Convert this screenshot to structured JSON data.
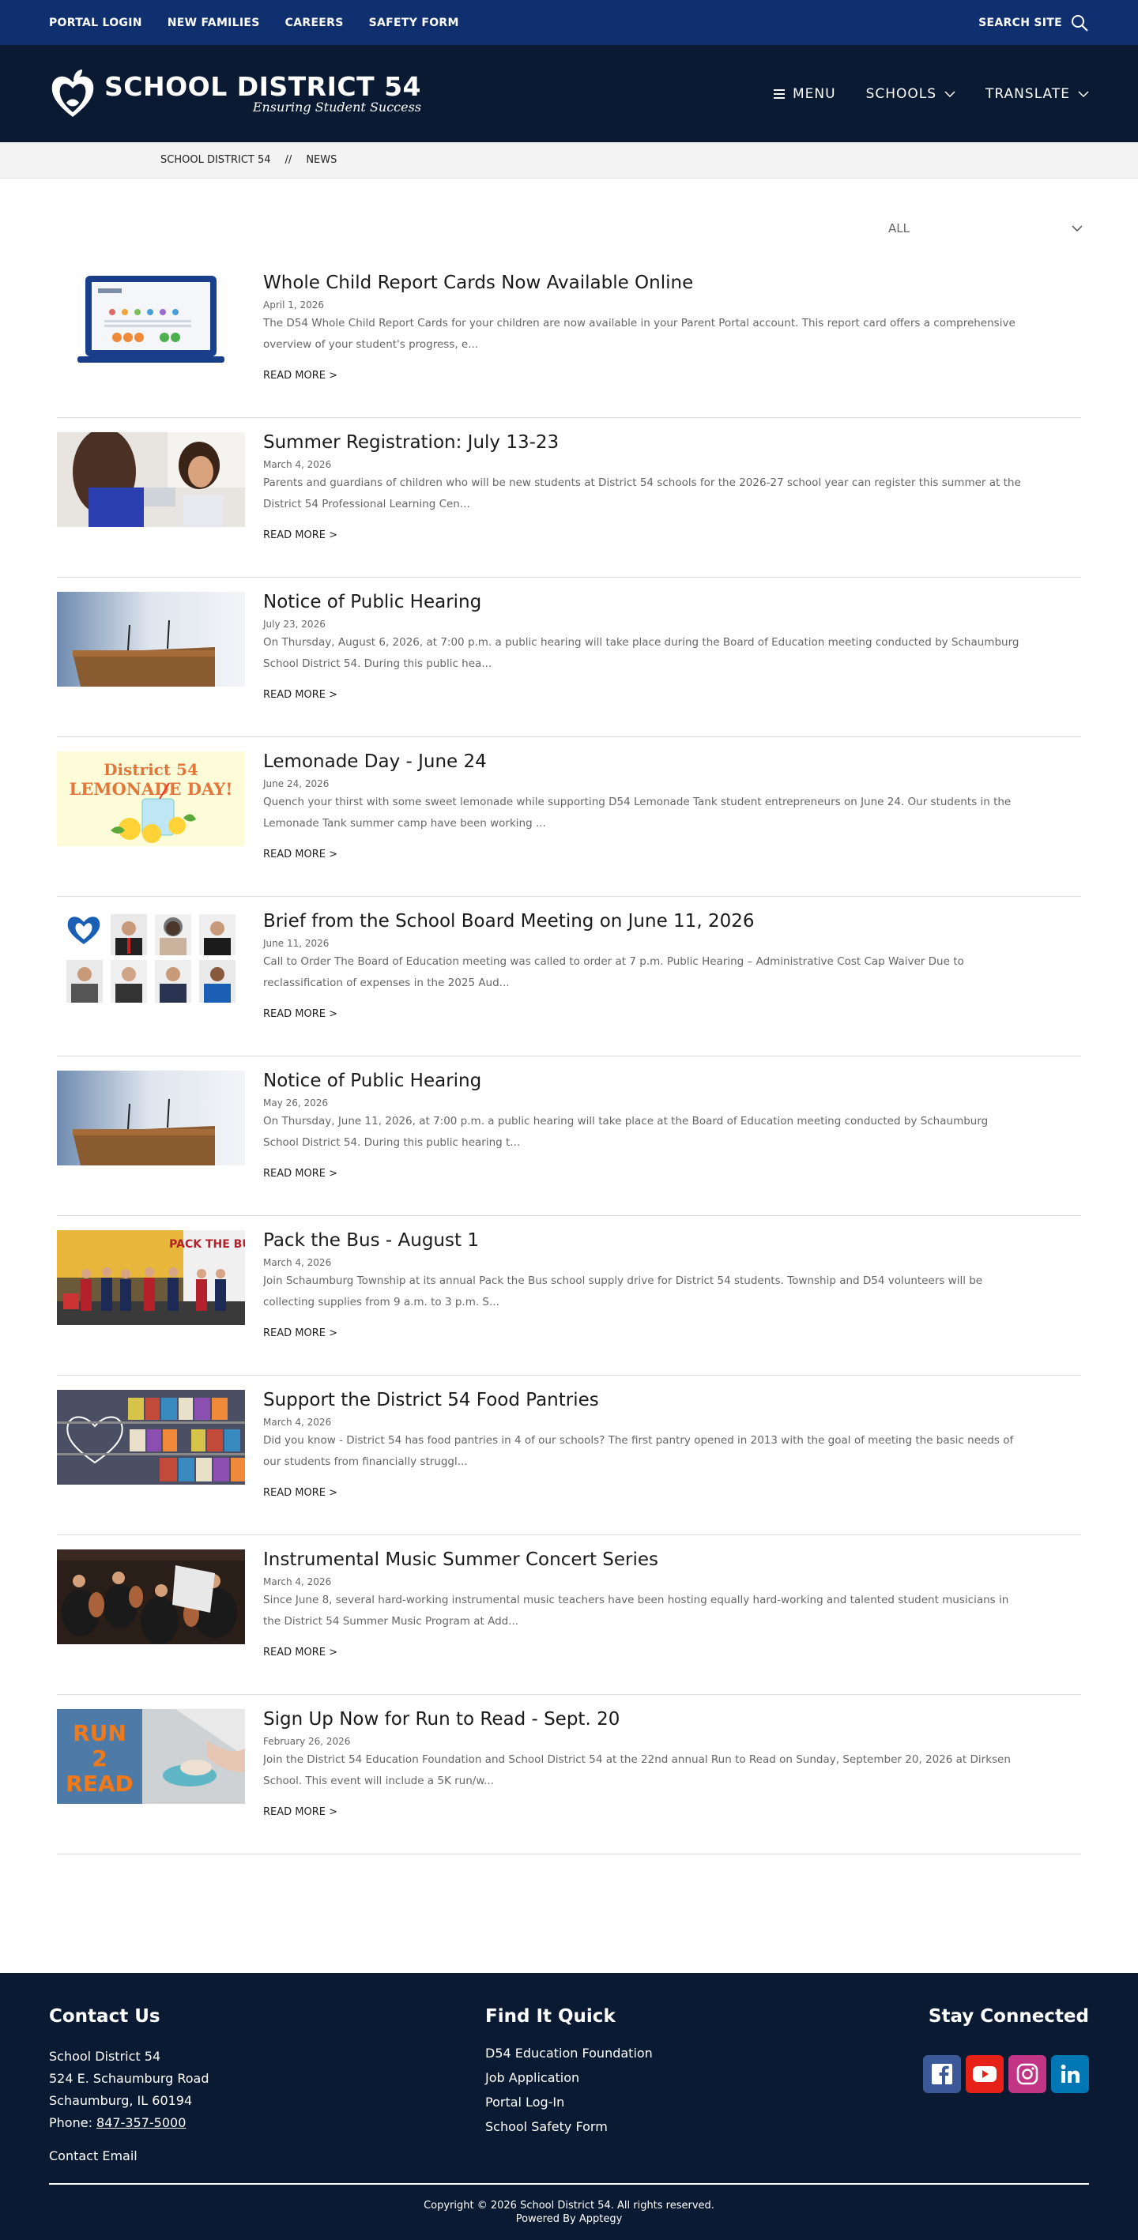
{
  "topbar": {
    "links": [
      "PORTAL LOGIN",
      "NEW FAMILIES",
      "CAREERS",
      "SAFETY FORM"
    ],
    "search_label": "SEARCH SITE"
  },
  "header": {
    "logo_name": "SCHOOL DISTRICT 54",
    "logo_tagline": "Ensuring Student Success",
    "nav": [
      "MENU",
      "SCHOOLS",
      "TRANSLATE"
    ]
  },
  "breadcrumb": {
    "home": "SCHOOL DISTRICT 54",
    "separator": "//",
    "current": "NEWS"
  },
  "filter": {
    "value": "ALL"
  },
  "news": [
    {
      "title": "Whole Child Report Cards Now Available Online",
      "date": "April 1, 2026",
      "excerpt": "The D54 Whole Child Report Cards for your children are now available in your Parent Portal account. This report card offers a comprehensive overview of your student's progress, e...",
      "read_more": "READ MORE >"
    },
    {
      "title": "Summer Registration: July 13-23",
      "date": "March 4, 2026",
      "excerpt": "Parents and guardians of children who will be new students at District 54 schools for the 2026-27 school year can register this summer at the District 54 Professional Learning Cen...",
      "read_more": "READ MORE >"
    },
    {
      "title": "Notice of Public Hearing",
      "date": "July 23, 2026",
      "excerpt": "On Thursday, August 6, 2026, at 7:00 p.m. a public hearing will take place during the Board of Education meeting conducted by Schaumburg School District 54. During this public hea...",
      "read_more": "READ MORE >"
    },
    {
      "title": "Lemonade Day - June 24",
      "date": "June 24, 2026",
      "excerpt": "Quench your thirst with some sweet lemonade while supporting D54 Lemonade Tank student entrepreneurs on June 24. Our students in the Lemonade Tank summer camp have been working ...",
      "read_more": "READ MORE >"
    },
    {
      "title": "Brief from the School Board Meeting on June 11, 2026",
      "date": "June 11, 2026",
      "excerpt": "Call to Order The Board of Education meeting was called to order at 7 p.m. Public Hearing – Administrative Cost Cap Waiver Due to reclassification of expenses in the 2025 Aud...",
      "read_more": "READ MORE >"
    },
    {
      "title": "Notice of Public Hearing",
      "date": "May 26, 2026",
      "excerpt": "On Thursday, June 11, 2026, at 7:00 p.m. a public hearing will take place at the Board of Education meeting conducted by Schaumburg School District 54. During this public hearing t...",
      "read_more": "READ MORE >"
    },
    {
      "title": "Pack the Bus - August 1",
      "date": "March 4, 2026",
      "excerpt": "Join Schaumburg Township at its annual Pack the Bus school supply drive for District 54 students. Township and D54 volunteers will be collecting supplies from 9 a.m. to 3 p.m. S...",
      "read_more": "READ MORE >"
    },
    {
      "title": "Support the District 54 Food Pantries",
      "date": "March 4, 2026",
      "excerpt": "Did you know - District 54 has food pantries in 4 of our schools? The first pantry opened in 2013 with the goal of meeting the basic needs of our students from financially struggl...",
      "read_more": "READ MORE >"
    },
    {
      "title": "Instrumental Music Summer Concert Series",
      "date": "March 4, 2026",
      "excerpt": "Since June 8, several hard-working instrumental music teachers have been hosting equally hard-working and talented student musicians in the District 54 Summer Music Program at Add...",
      "read_more": "READ MORE >"
    },
    {
      "title": "Sign Up Now for Run to Read - Sept. 20",
      "date": "February 26, 2026",
      "excerpt": "Join the District 54 Education Foundation and School District 54 at the 22nd annual Run to Read on Sunday, September 20, 2026 at Dirksen School. This event will include a 5K run/w...",
      "read_more": "READ MORE >"
    }
  ],
  "image_text": {
    "lemonade_line1": "District 54",
    "lemonade_line2": "LEMONADE DAY!",
    "pack_bus": "PACK THE BUS",
    "run_read_1": "RUN",
    "run_read_2": "2",
    "run_read_3": "READ"
  },
  "footer": {
    "contact_title": "Contact Us",
    "contact_lines": [
      "School District 54",
      "524 E. Schaumburg Road",
      "Schaumburg, IL 60194"
    ],
    "phone_label": "Phone: ",
    "phone": "847-357-5000",
    "contact_email": "Contact Email",
    "find_title": "Find It Quick",
    "find_links": [
      "D54 Education Foundation",
      "Job Application",
      "Portal Log-In",
      "School Safety Form"
    ],
    "stay_title": "Stay Connected",
    "social": [
      "facebook-icon",
      "youtube-icon",
      "instagram-icon",
      "linkedin-icon"
    ],
    "copyright": "Copyright © 2026 School District 54. All rights reserved.",
    "powered": "Powered By Apptegy"
  },
  "colors": {
    "topbar": "#0f2f6e",
    "header": "#0b1a33",
    "footer": "#0b1a33",
    "facebook": "#3b5998",
    "youtube": "#e62117",
    "instagram": "#c13584",
    "linkedin": "#0077b5"
  }
}
